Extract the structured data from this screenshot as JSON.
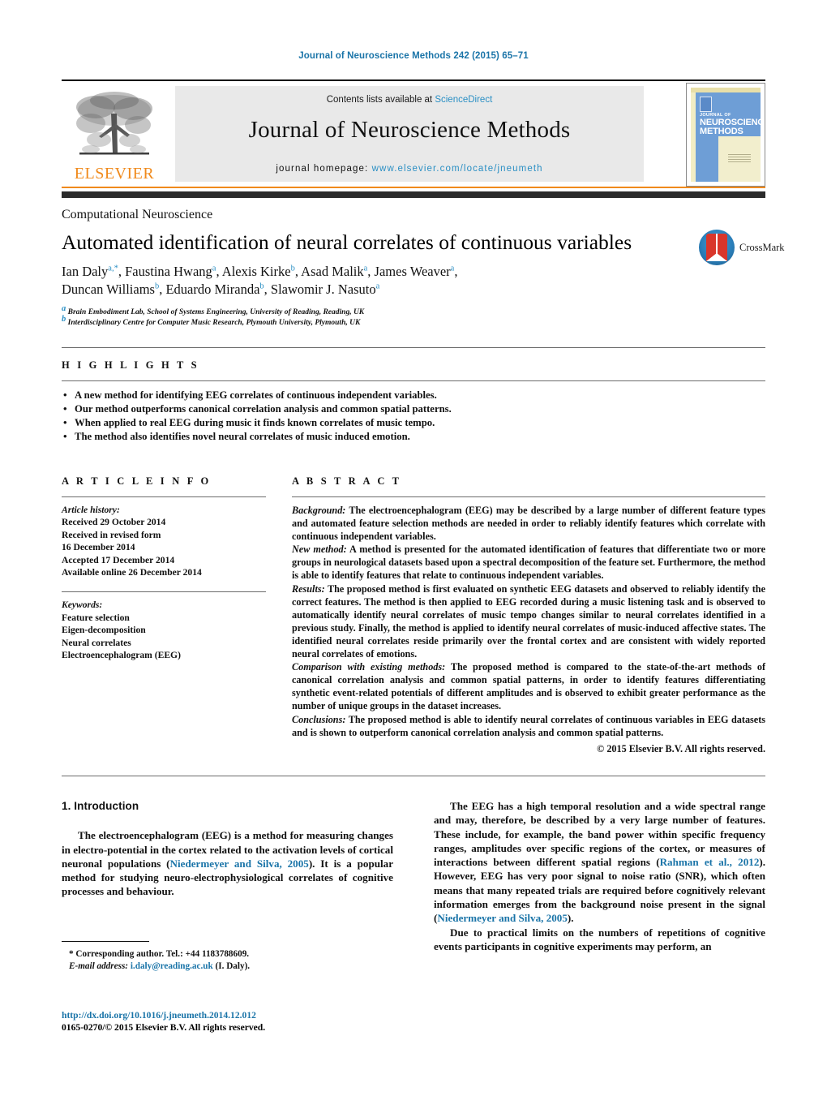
{
  "running_head": "Journal of Neuroscience Methods 242 (2015) 65–71",
  "masthead": {
    "publisher": "ELSEVIER",
    "contents_prefix": "Contents lists available at ",
    "contents_link": "ScienceDirect",
    "journal_name": "Journal of Neuroscience Methods",
    "homepage_prefix": "journal homepage: ",
    "homepage_url": "www.elsevier.com/locate/jneumeth",
    "cover": {
      "line1": "JOURNAL OF",
      "line2": "NEUROSCIENCE",
      "line3": "METHODS"
    }
  },
  "article": {
    "section_label": "Computational Neuroscience",
    "title": "Automated identification of neural correlates of continuous variables",
    "crossmark_label": "CrossMark",
    "authors_line1": "Ian Daly<sup>a,*</sup>, Faustina Hwang<sup>a</sup>, Alexis Kirke<sup>b</sup>, Asad Malik<sup>a</sup>, James Weaver<sup>a</sup>,",
    "authors_line2": "Duncan Williams<sup>b</sup>, Eduardo Miranda<sup>b</sup>, Slawomir J. Nasuto<sup>a</sup>",
    "affiliation_a": "<sup>a</sup> Brain Embodiment Lab, School of Systems Engineering, University of Reading, Reading, UK",
    "affiliation_b": "<sup>b</sup> Interdisciplinary Centre for Computer Music Research, Plymouth University, Plymouth, UK"
  },
  "highlights": {
    "heading": "H I G H L I G H T S",
    "items": [
      "A new method for identifying EEG correlates of continuous independent variables.",
      "Our method outperforms canonical correlation analysis and common spatial patterns.",
      "When applied to real EEG during music it finds known correlates of music tempo.",
      "The method also identifies novel neural correlates of music induced emotion."
    ]
  },
  "article_info": {
    "heading": "A R T I C L E    I N F O",
    "history_label": "Article history:",
    "history": [
      "Received 29 October 2014",
      "Received in revised form",
      "16 December 2014",
      "Accepted 17 December 2014",
      "Available online 26 December 2014"
    ],
    "keywords_label": "Keywords:",
    "keywords": [
      "Feature selection",
      "Eigen-decomposition",
      "Neural correlates",
      "Electroencephalogram (EEG)"
    ]
  },
  "abstract": {
    "heading": "A B S T R A C T",
    "background_label": "Background:",
    "background_text": " The electroencephalogram (EEG) may be described by a large number of different feature types and automated feature selection methods are needed in order to reliably identify features which correlate with continuous independent variables.",
    "newmethod_label": "New method:",
    "newmethod_text": " A method is presented for the automated identification of features that differentiate two or more groups in neurological datasets based upon a spectral decomposition of the feature set. Furthermore, the method is able to identify features that relate to continuous independent variables.",
    "results_label": "Results:",
    "results_text": " The proposed method is first evaluated on synthetic EEG datasets and observed to reliably identify the correct features. The method is then applied to EEG recorded during a music listening task and is observed to automatically identify neural correlates of music tempo changes similar to neural correlates identified in a previous study. Finally, the method is applied to identify neural correlates of music-induced affective states. The identified neural correlates reside primarily over the frontal cortex and are consistent with widely reported neural correlates of emotions.",
    "comparison_label": "Comparison with existing methods:",
    "comparison_text": " The proposed method is compared to the state-of-the-art methods of canonical correlation analysis and common spatial patterns, in order to identify features differentiating synthetic event-related potentials of different amplitudes and is observed to exhibit greater performance as the number of unique groups in the dataset increases.",
    "conclusions_label": "Conclusions:",
    "conclusions_text": " The proposed method is able to identify neural correlates of continuous variables in EEG datasets and is shown to outperform canonical correlation analysis and common spatial patterns.",
    "copyright": "© 2015 Elsevier B.V. All rights reserved."
  },
  "introduction": {
    "heading": "1. Introduction",
    "left_p1_a": "The electroencephalogram (EEG) is a method for measuring changes in electro-potential in the cortex related to the activation levels of cortical neuronal populations (",
    "left_p1_ref": "Niedermeyer and Silva, 2005",
    "left_p1_b": "). It is a popular method for studying neuro-electrophysiological correlates of cognitive processes and behaviour.",
    "right_p1_a": "The EEG has a high temporal resolution and a wide spectral range and may, therefore, be described by a very large number of features. These include, for example, the band power within specific frequency ranges, amplitudes over specific regions of the cortex, or measures of interactions between different spatial regions (",
    "right_p1_ref1": "Rahman et al., 2012",
    "right_p1_b": "). However, EEG has very poor signal to noise ratio (SNR), which often means that many repeated trials are required before cognitively relevant information emerges from the background noise present in the signal (",
    "right_p1_ref2": "Niedermeyer and Silva, 2005",
    "right_p1_c": ").",
    "right_p2": "Due to practical limits on the numbers of repetitions of cognitive events participants in cognitive experiments may perform, an"
  },
  "footnote": {
    "corresponding": "* Corresponding author. Tel.: +44 1183788609.",
    "email_label": "E-mail address:",
    "email": "i.daly@reading.ac.uk",
    "email_suffix": " (I. Daly)."
  },
  "footer": {
    "doi": "http://dx.doi.org/10.1016/j.jneumeth.2014.12.012",
    "issn_line": "0165-0270/© 2015 Elsevier B.V. All rights reserved."
  },
  "colors": {
    "link": "#1a74a8",
    "elsevier_orange": "#f08a1c",
    "masthead_band": "#e9e9e9",
    "dark_bar": "#2b2b2b",
    "crossmark_red": "#d9362b",
    "crossmark_blue": "#2a7fba"
  }
}
